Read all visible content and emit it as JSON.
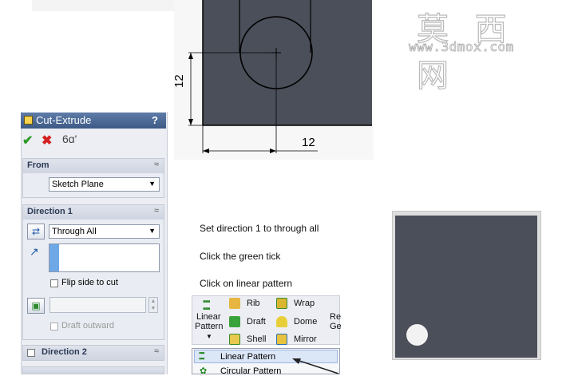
{
  "watermark": {
    "chinese": "莫 西 网",
    "url": "www.3dmox.com"
  },
  "sketch": {
    "dim_vertical": "12",
    "dim_horizontal": "12",
    "fill_color": "#4b4f5a"
  },
  "panel": {
    "title": "Cut-Extrude",
    "help": "?",
    "ok_icon": "✔",
    "cancel_icon": "✖",
    "detailed_preview_icon": "6ɑ'",
    "from": {
      "label": "From",
      "chevron": "≈",
      "start_condition": "Sketch Plane"
    },
    "direction1": {
      "label": "Direction 1",
      "chevron": "≈",
      "end_condition": "Through All",
      "flip_label": "Flip side to cut",
      "draft_label": "Draft outward"
    },
    "direction2": {
      "label": "Direction 2",
      "chevron": "≈"
    }
  },
  "instructions": {
    "step1": "Set direction 1 to through all",
    "step2": "Click  the green tick",
    "step3": "Click on linear pattern"
  },
  "toolbar": {
    "linear_pattern_line1": "Linear",
    "linear_pattern_line2": "Pattern",
    "rib": "Rib",
    "draft": "Draft",
    "shell": "Shell",
    "wrap": "Wrap",
    "dome": "Dome",
    "mirror": "Mirror",
    "cut_off_1": "Re",
    "cut_off_2": "Ge"
  },
  "menu": {
    "item1": "Linear Pattern",
    "item2": "Circular Pattern"
  },
  "colors": {
    "accent_green": "#2f9a2a",
    "cancel_red": "#d32020",
    "title_blue": "#4a6a98",
    "part_grey": "#4b4f5a"
  }
}
